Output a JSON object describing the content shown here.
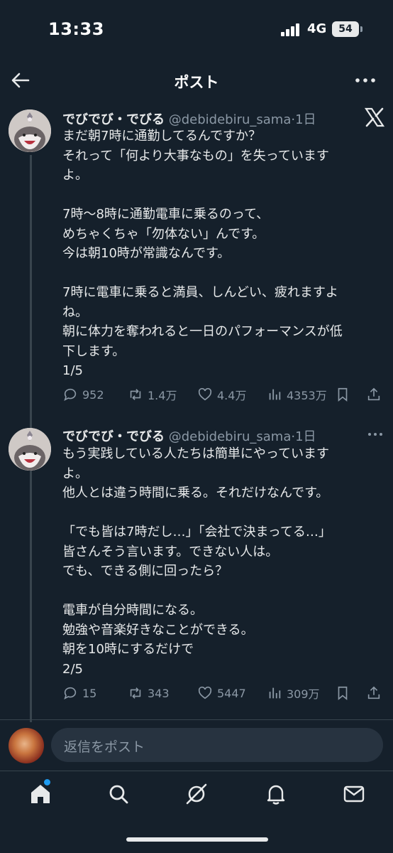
{
  "status_bar": {
    "time": "13:33",
    "network": "4G",
    "battery": "54"
  },
  "header": {
    "title": "ポスト"
  },
  "tweets": [
    {
      "name": "でびでび・でびる",
      "handle": "@debidebiru_sama",
      "time": "·1日",
      "text": "まだ朝7時に通勤してるんですか？\nそれって「何より大事なもの」を失っています\nよ。\n\n7時〜8時に通勤電車に乗るのって、\nめちゃくちゃ「勿体ない」んです。\n今は朝10時が常識なんです。\n\n7時に電車に乗ると満員、しんどい、疲れますよ\nね。\n朝に体力を奪われると一日のパフォーマンスが低\n下します。\n1/5",
      "replies": "952",
      "retweets": "1.4万",
      "likes": "4.4万",
      "views": "4353万"
    },
    {
      "name": "でびでび・でびる",
      "handle": "@debidebiru_sama",
      "time": "·1日",
      "text": "もう実践している人たちは簡単にやっています\nよ。\n他人とは違う時間に乗る。それだけなんです。\n\n「でも皆は7時だし…」「会社で決まってる…」\n皆さんそう言います。できない人は。\nでも、できる側に回ったら？\n\n電車が自分時間になる。\n勉強や音楽好きなことができる。\n朝を10時にするだけで\n2/5",
      "replies": "15",
      "retweets": "343",
      "likes": "5447",
      "views": "309万"
    }
  ],
  "reply_bar": {
    "placeholder": "返信をポスト"
  },
  "colors": {
    "background": "#15202b",
    "accent": "#1d9bf0",
    "muted": "#8b98a5",
    "text": "#e7e9ea"
  },
  "icons": [
    "back-arrow-icon",
    "more-icon",
    "x-logo-icon",
    "reply-icon",
    "retweet-icon",
    "like-icon",
    "views-icon",
    "bookmark-icon",
    "share-icon",
    "home-icon",
    "search-icon",
    "grok-icon",
    "notifications-icon",
    "messages-icon"
  ]
}
